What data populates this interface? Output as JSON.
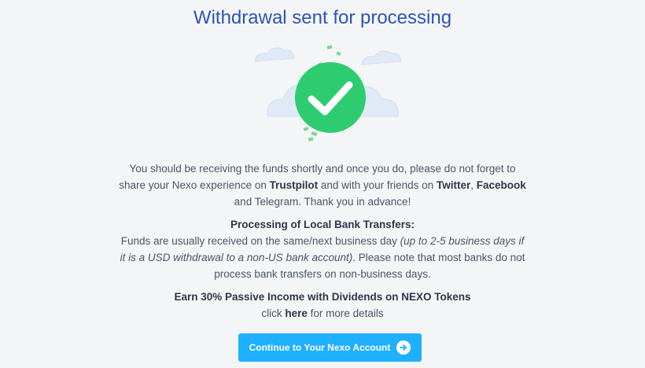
{
  "title": "Withdrawal sent for processing",
  "message": {
    "part1": "You should be receiving the funds shortly and once you do, please do not forget to share your Nexo experience on ",
    "trustpilot": "Trustpilot",
    "part2": " and with your friends on ",
    "twitter": "Twitter",
    "part3": ", ",
    "facebook": "Facebook",
    "part4": " and Telegram. Thank you in advance!"
  },
  "local_transfers": {
    "heading": "Processing of Local Bank Transfers:",
    "text1": "Funds are usually received on the same/next business day ",
    "italic": "(up to 2-5 business days if it is a USD withdrawal to a non-US bank account)",
    "text2": ". Please note that most banks do not process bank transfers on non-business days."
  },
  "promo": {
    "heading": "Earn 30% Passive Income with Dividends on NEXO Tokens",
    "pre_link": "click ",
    "link": "here",
    "post_link": " for more details"
  },
  "cta": {
    "label": "Continue to Your Nexo Account",
    "icon": "arrow-right-icon"
  },
  "colors": {
    "title": "#2f54b3",
    "check": "#2ecc71",
    "button": "#1fb0ff",
    "cloud": "#dde9f6"
  },
  "hero_icon": "success-check-icon"
}
